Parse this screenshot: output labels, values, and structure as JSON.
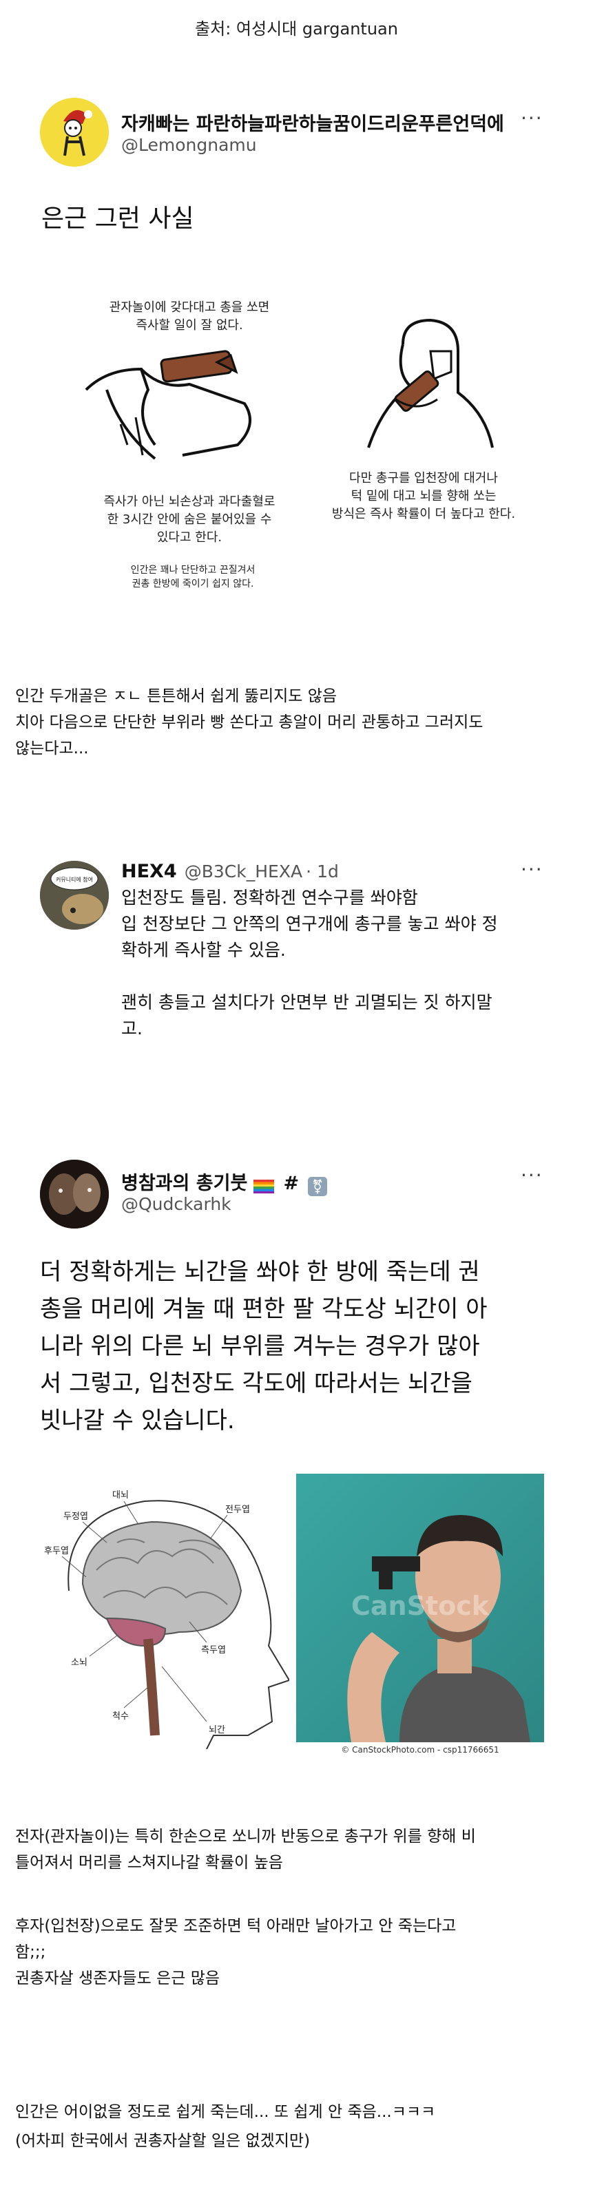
{
  "source": "출처: 여성시대 gargantuan",
  "tweet1": {
    "name": "자캐빠는 파란하늘파란하늘꿈이드리운푸른언덕에",
    "handle": "@Lemongnamu",
    "more": "···",
    "text": "은근 그런 사실",
    "caption_left_top": [
      "관자놀이에 갖다대고 총을 쏘면",
      "즉사할 일이 잘 없다."
    ],
    "caption_left_bottom": [
      "즉사가 아닌 뇌손상과 과다출혈로",
      "한 3시간 안에 숨은 붙어있을 수",
      "있다고 한다."
    ],
    "caption_left_small": [
      "인간은 꽤나 단단하고 끈질겨서",
      "권총 한방에 죽이기 쉽지 않다."
    ],
    "caption_right": [
      "다만 총구를 입천장에 대거나",
      "턱 밑에 대고 뇌를 향해 쏘는",
      "방식은 즉사 확률이 더 높다고 한다."
    ]
  },
  "comment1": [
    "인간 두개골은 ㅈㄴ 튼튼해서 쉽게 뚫리지도 않음",
    "치아 다음으로 단단한 부위라 빵 쏜다고 총알이 머리 관통하고 그러지도",
    "않는다고..."
  ],
  "tweet2": {
    "name": "HEX4",
    "handle": "@B3Ck_HEXA",
    "time": "· 1d",
    "more": "···",
    "avatar_text": "커뮤니티에 참여",
    "lines": [
      "입천장도 틀림. 정확하겐 연수구를 쏴야함",
      "입 천장보단 그 안쪽의 연구개에 총구를 놓고 쏴야 정",
      "확하게 즉사할 수 있음.",
      "",
      "괜히 총들고 설치다가 안면부 반 괴멸되는 짓 하지말",
      "고."
    ]
  },
  "tweet3": {
    "name": "병참과의 총기붓",
    "suffix": "#",
    "handle": "@Qudckarhk",
    "more": "···",
    "lines": [
      "더 정확하게는 뇌간을 쏴야 한 방에 죽는데 권",
      "총을 머리에 겨눌 때 편한 팔 각도상 뇌간이 아",
      "니라 위의 다른 뇌 부위를 겨누는 경우가 많아",
      "서 그렇고, 입천장도 각도에 따라서는 뇌간을",
      "빗나갈 수 있습니다."
    ],
    "brain_labels": {
      "top": "대뇌",
      "parietal": "두정엽",
      "frontal": "전두엽",
      "occipital": "후두엽",
      "temporal": "측두엽",
      "cerebellum": "소뇌",
      "spinal": "척수",
      "brainstem": "뇌간"
    },
    "photo_watermark": "CanStock",
    "photo_credit": "© CanStockPhoto.com - csp11766651"
  },
  "comment2": [
    "전자(관자놀이)는 특히 한손으로 쏘니까 반동으로 총구가 위를 향해 비",
    "틀어져서 머리를 스쳐지나갈 확률이 높음"
  ],
  "comment3": [
    "후자(입천장)으로도 잘못 조준하면 턱 아래만 날아가고 안 죽는다고",
    "함;;;",
    "권총자살 생존자들도 은근 많음"
  ],
  "comment4": [
    "인간은 어이없을 정도로 쉽게 죽는데... 또 쉽게 안 죽음...ㅋㅋㅋ",
    "(어차피 한국에서 권총자살할 일은 없겠지만)"
  ]
}
